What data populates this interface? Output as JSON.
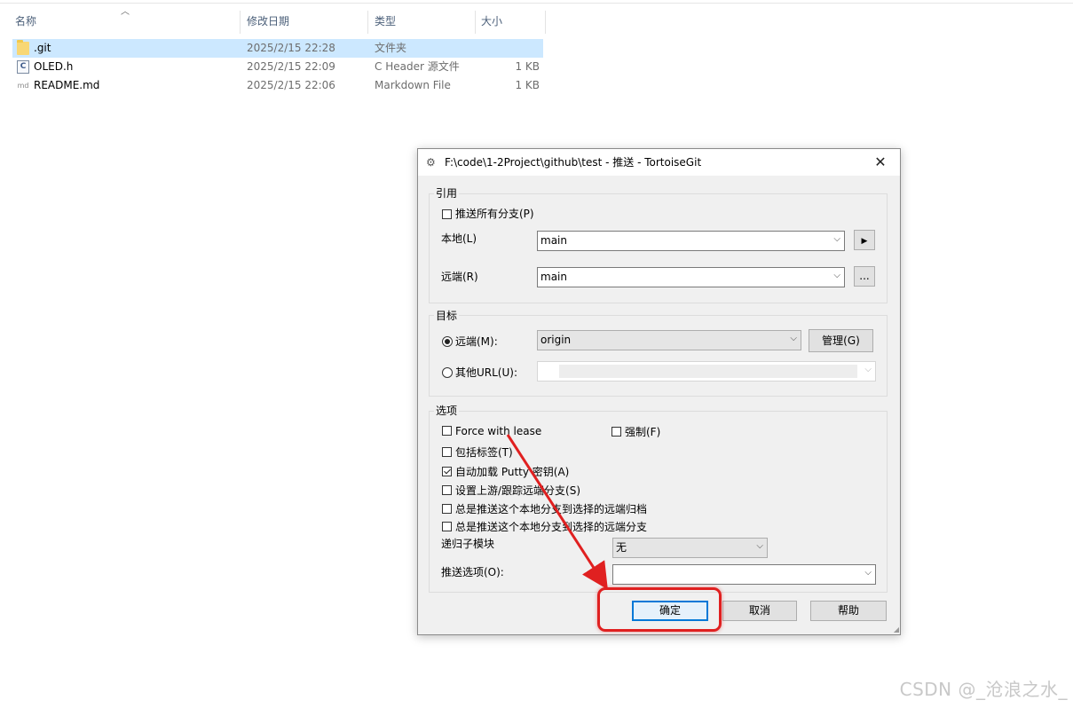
{
  "explorer": {
    "columns": [
      "名称",
      "修改日期",
      "类型",
      "大小"
    ],
    "files": [
      {
        "name": ".git",
        "date": "2025/2/15 22:28",
        "type": "文件夹",
        "size": "",
        "icon": "folder-icon",
        "selected": true
      },
      {
        "name": "OLED.h",
        "date": "2025/2/15 22:09",
        "type": "C Header 源文件",
        "size": "1 KB",
        "icon": "c-header-file-icon",
        "icon_glyph": "C",
        "selected": false
      },
      {
        "name": "README.md",
        "date": "2025/2/15 22:06",
        "type": "Markdown File",
        "size": "1 KB",
        "icon": "markdown-file-icon",
        "icon_glyph": "md",
        "selected": false
      }
    ]
  },
  "dialog": {
    "title": "F:\\code\\1-2Project\\github\\test - 推送 - TortoiseGit",
    "close_glyph": "✕",
    "ref_group": {
      "label": "引用",
      "push_all_branches": "推送所有分支(P)",
      "push_all_checked": false,
      "local_label": "本地(L)",
      "local_value": "main",
      "local_btn_glyph": "▶",
      "remote_label": "远端(R)",
      "remote_value": "main",
      "remote_btn": "..."
    },
    "target_group": {
      "label": "目标",
      "remote_radio": "远端(M):",
      "remote_selected": true,
      "remote_value": "origin",
      "manage_button": "管理(G)",
      "other_url_radio": "其他URL(U):"
    },
    "options_group": {
      "label": "选项",
      "force_with_lease": "Force with lease",
      "force": "强制(F)",
      "include_tags": "包括标签(T)",
      "autoload_putty": "自动加载 Putty 密钥(A)",
      "autoload_putty_checked": true,
      "set_upstream": "设置上游/跟踪远端分支(S)",
      "always_push_archive": "总是推送这个本地分支到选择的远端归档",
      "always_push_branch": "总是推送这个本地分支到选择的远端分支",
      "recurse_submodules_label": "递归子模块",
      "recurse_submodules_value": "无",
      "push_options_label": "推送选项(O):",
      "push_options_value": ""
    },
    "buttons": {
      "ok": "确定",
      "cancel": "取消",
      "help": "帮助"
    },
    "dropdown_glyph": "⌵"
  },
  "annotation": {
    "color": "#e02020"
  },
  "watermark": "CSDN @_沧浪之水_"
}
